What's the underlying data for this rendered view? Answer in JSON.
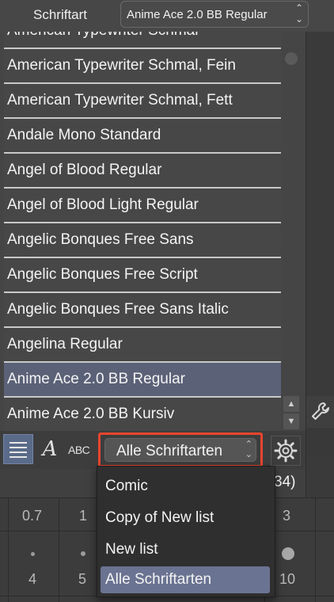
{
  "header": {
    "font_label": "Schriftart",
    "font_value": "Anime Ace 2.0 BB Regular"
  },
  "font_list": {
    "items": [
      "American Typewriter Schmal",
      "American Typewriter Schmal, Fein",
      "American Typewriter Schmal, Fett",
      "Andale Mono Standard",
      "Angel of Blood Regular",
      "Angel of Blood Light Regular",
      "Angelic Bonques Free Sans",
      "Angelic Bonques Free Script",
      "Angelic Bonques Free Sans Italic",
      "Angelina Regular",
      "Anime Ace 2.0 BB Regular",
      "Anime Ace 2.0 BB Kursiv"
    ],
    "selected": "Anime Ace 2.0 BB Regular"
  },
  "toolbar": {
    "script_icon_glyph": "A",
    "abc_label": "ABC",
    "set_value": "Alle Schriftarten",
    "count_text": "34)"
  },
  "set_menu": {
    "items": [
      "Comic",
      "Copy of New list",
      "New list",
      "Alle Schriftarten"
    ],
    "active": "Alle Schriftarten"
  },
  "background_grid": {
    "row1": [
      "0.7",
      "1",
      "3"
    ],
    "row2": [
      "4",
      "5",
      "10"
    ]
  },
  "icons": {
    "list_view": "list-icon",
    "script_view": "script-a-icon",
    "gear": "gear-icon",
    "wrench": "wrench-icon"
  },
  "colors": {
    "selection": "#5b6177",
    "highlight_border": "#e8452f",
    "menu_active": "#6a7391"
  }
}
